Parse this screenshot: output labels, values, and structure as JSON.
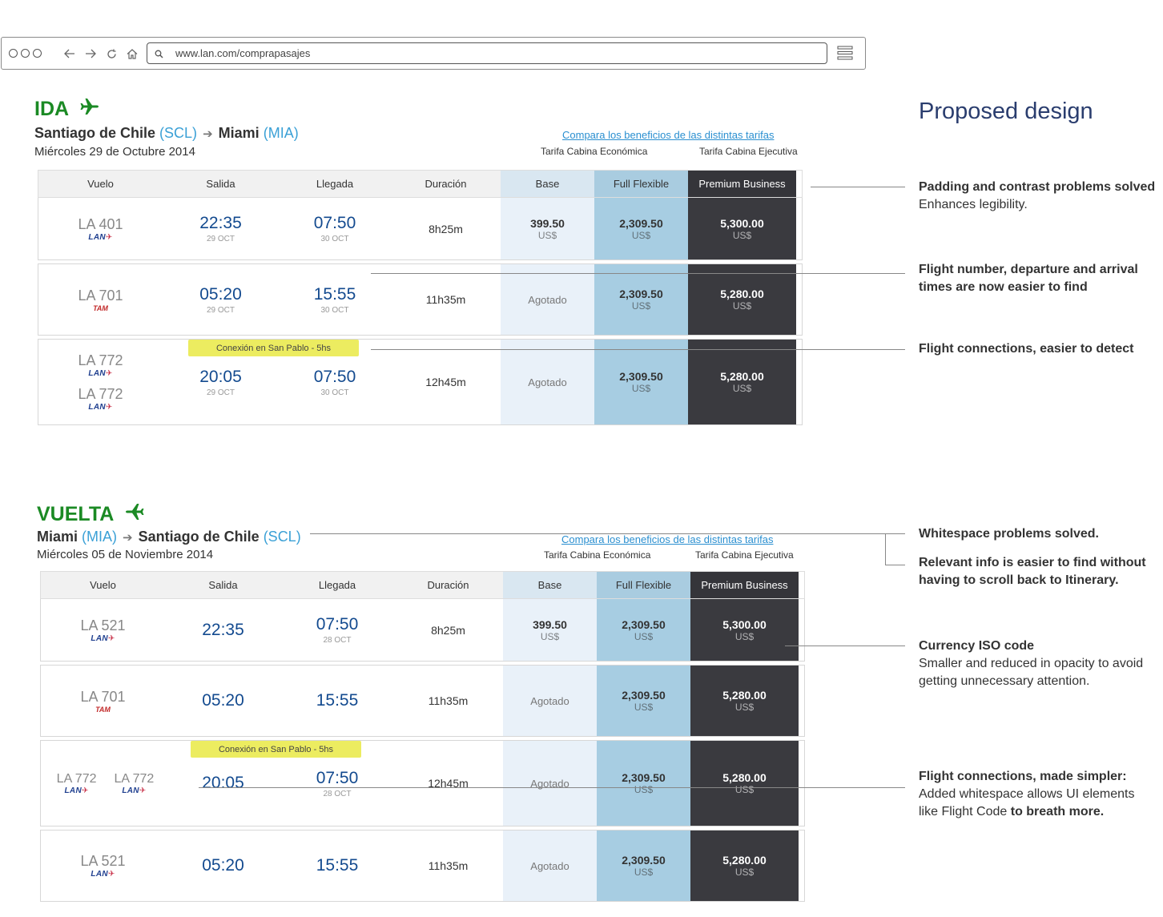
{
  "browser": {
    "url": "www.lan.com/comprapasajes"
  },
  "proposed_title": "Proposed design",
  "ida": {
    "title": "IDA",
    "origin": "Santiago de Chile",
    "origin_code": "(SCL)",
    "dest": "Miami",
    "dest_code": "(MIA)",
    "date": "Miércoles 29 de Octubre 2014",
    "compare": "Compara los beneficios de las distintas tarifas",
    "tarifa_eco": "Tarifa Cabina Económica",
    "tarifa_eje": "Tarifa Cabina Ejecutiva",
    "headers": {
      "vuelo": "Vuelo",
      "salida": "Salida",
      "llegada": "Llegada",
      "duracion": "Duración",
      "base": "Base",
      "flex": "Full Flexible",
      "prem": "Premium Business"
    },
    "rows": [
      {
        "flight": "LA 401",
        "airline": "LAN",
        "dep": "22:35",
        "dep_date": "29 OCT",
        "arr": "07:50",
        "arr_date": "30 OCT",
        "dur": "8h25m",
        "base": "399.50",
        "base_cur": "US$",
        "flex": "2,309.50",
        "flex_cur": "US$",
        "prem": "5,300.00",
        "prem_cur": "US$"
      },
      {
        "flight": "LA 701",
        "airline": "TAM",
        "dep": "05:20",
        "dep_date": "29 OCT",
        "arr": "15:55",
        "arr_date": "30 OCT",
        "dur": "11h35m",
        "base": "Agotado",
        "flex": "2,309.50",
        "flex_cur": "US$",
        "prem": "5,280.00",
        "prem_cur": "US$"
      },
      {
        "flight": "LA 772",
        "flight2": "LA 772",
        "airline": "LAN",
        "dep": "20:05",
        "dep_date": "29 OCT",
        "arr": "07:50",
        "arr_date": "30 OCT",
        "dur": "12h45m",
        "base": "Agotado",
        "flex": "2,309.50",
        "flex_cur": "US$",
        "prem": "5,280.00",
        "prem_cur": "US$",
        "connection": "Conexión en San Pablo - 5hs"
      }
    ]
  },
  "vuelta": {
    "title": "VUELTA",
    "origin": "Miami",
    "origin_code": "(MIA)",
    "dest": "Santiago de Chile",
    "dest_code": "(SCL)",
    "date": "Miércoles 05 de Noviembre 2014",
    "compare": "Compara los beneficios de las distintas tarifas",
    "tarifa_eco": "Tarifa Cabina Económica",
    "tarifa_eje": "Tarifa Cabina Ejecutiva",
    "headers": {
      "vuelo": "Vuelo",
      "salida": "Salida",
      "llegada": "Llegada",
      "duracion": "Duración",
      "base": "Base",
      "flex": "Full Flexible",
      "prem": "Premium Business"
    },
    "rows": [
      {
        "flight": "LA 521",
        "airline": "LAN",
        "dep": "22:35",
        "arr": "07:50",
        "arr_date": "28 OCT",
        "dur": "8h25m",
        "base": "399.50",
        "base_cur": "US$",
        "flex": "2,309.50",
        "flex_cur": "US$",
        "prem": "5,300.00",
        "prem_cur": "US$"
      },
      {
        "flight": "LA 701",
        "airline": "TAM",
        "dep": "05:20",
        "arr": "15:55",
        "dur": "11h35m",
        "base": "Agotado",
        "flex": "2,309.50",
        "flex_cur": "US$",
        "prem": "5,280.00",
        "prem_cur": "US$"
      },
      {
        "flight": "LA 772",
        "flight2": "LA 772",
        "airline": "LAN",
        "dep": "20:05",
        "arr": "07:50",
        "arr_date": "28 OCT",
        "dur": "12h45m",
        "base": "Agotado",
        "flex": "2,309.50",
        "flex_cur": "US$",
        "prem": "5,280.00",
        "prem_cur": "US$",
        "connection": "Conexión en San Pablo - 5hs"
      },
      {
        "flight": "LA 521",
        "airline": "LAN",
        "dep": "05:20",
        "arr": "15:55",
        "dur": "11h35m",
        "base": "Agotado",
        "flex": "2,309.50",
        "flex_cur": "US$",
        "prem": "5,280.00",
        "prem_cur": "US$"
      }
    ]
  },
  "annotations": {
    "a1_bold": "Padding and contrast problems solved",
    "a1_text": "Enhances legibility.",
    "a2_bold": "Flight number, departure and arrival times are now easier to find",
    "a3_bold": "Flight connections, easier to detect",
    "a4_bold": "Whitespace problems solved.",
    "a5_bold": "Relevant info is easier to find without having to scroll back to Itinerary.",
    "a6_bold": "Currency ISO code",
    "a6_text": "Smaller and reduced in opacity to avoid getting unnecessary attention.",
    "a7_bold": "Flight connections, made simpler:",
    "a7_text": "Added whitespace allows UI elements like Flight Code",
    "a7_bold2": "to breath more."
  },
  "colors": {
    "green": "#1b8a24",
    "blue": "#3aa0d6",
    "base": "#e9f1f9",
    "flex": "#a7cde2",
    "prem": "#3a3a3f",
    "connection": "#ecec60"
  }
}
